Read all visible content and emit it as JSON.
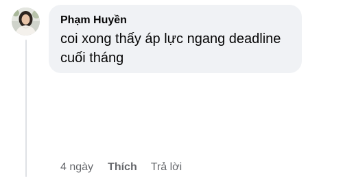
{
  "comment": {
    "author_name": "Phạm Huyền",
    "text": "coi xong thấy áp lực ngang deadline cuối tháng",
    "timestamp": "4 ngày",
    "like_label": "Thích",
    "reply_label": "Trả lời"
  },
  "colors": {
    "bubble_background": "#f0f2f5",
    "primary_text": "#050505",
    "secondary_text": "#65676b",
    "thread_line": "#dfe1e5"
  }
}
